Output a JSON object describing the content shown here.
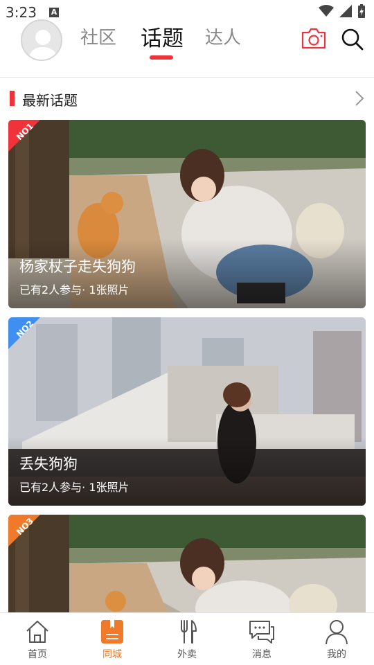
{
  "status_bar": {
    "time": "3:23",
    "notif_letter": "A"
  },
  "header": {
    "tabs": [
      {
        "label": "社区"
      },
      {
        "label": "话题"
      },
      {
        "label": "达人"
      }
    ],
    "active_tab": "话题",
    "accent": "#f0333a"
  },
  "section": {
    "title": "最新话题"
  },
  "topics": [
    {
      "badge": "NO1",
      "badge_color": "#f0333a",
      "title": "杨家杖子走失狗狗",
      "meta": "已有2人参与· 1张照片"
    },
    {
      "badge": "NO2",
      "badge_color": "#3f8ff0",
      "title": "丢失狗狗",
      "meta": "已有2人参与· 1张照片"
    },
    {
      "badge": "NO3",
      "badge_color": "#f07a2a",
      "title": "",
      "meta": ""
    }
  ],
  "bottom_nav": [
    {
      "label": "首页",
      "icon": "home-icon"
    },
    {
      "label": "同城",
      "icon": "city-bookmark-icon"
    },
    {
      "label": "外卖",
      "icon": "fork-knife-icon"
    },
    {
      "label": "消息",
      "icon": "chat-icon"
    },
    {
      "label": "我的",
      "icon": "person-icon"
    }
  ],
  "active_nav": "同城",
  "active_nav_color": "#f07a2a"
}
